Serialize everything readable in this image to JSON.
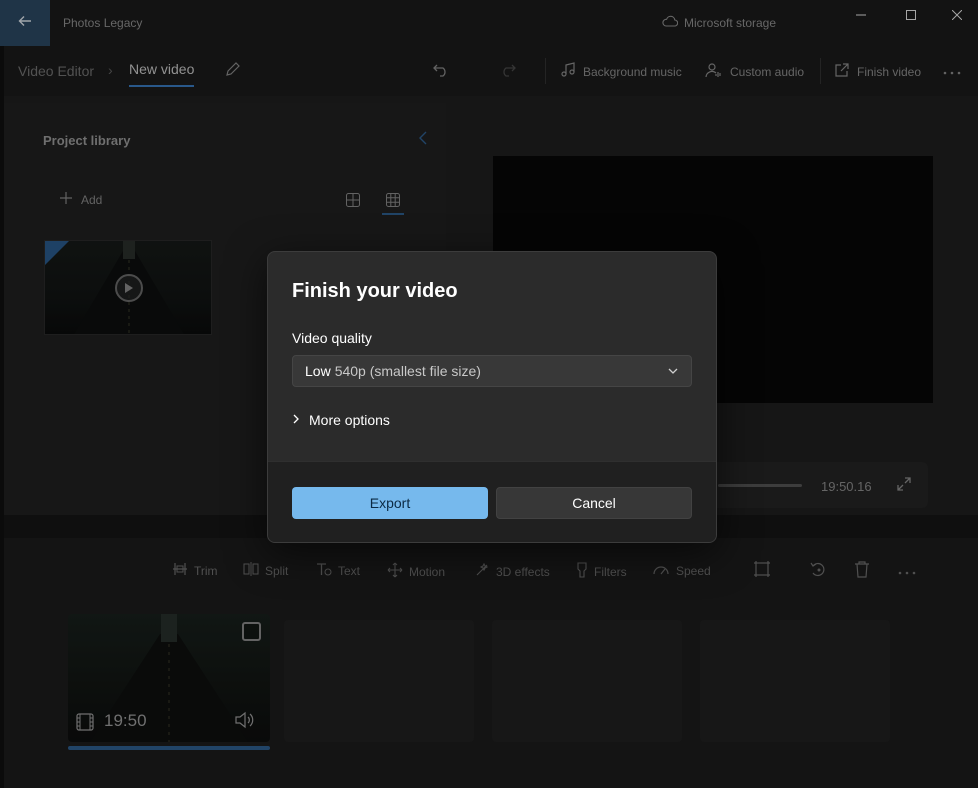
{
  "app": {
    "title": "Photos Legacy",
    "storage_label": "Microsoft storage"
  },
  "breadcrumb": {
    "root": "Video Editor",
    "separator": "›",
    "current": "New video"
  },
  "toolbar": {
    "background_music": "Background music",
    "custom_audio": "Custom audio",
    "finish_video": "Finish video"
  },
  "library": {
    "title": "Project library",
    "add_label": "Add"
  },
  "preview": {
    "time": "19:50.16"
  },
  "edit_toolbar": {
    "trim": "Trim",
    "split": "Split",
    "text": "Text",
    "motion": "Motion",
    "effects_3d": "3D effects",
    "filters": "Filters",
    "speed": "Speed"
  },
  "storyboard": {
    "clips": [
      {
        "duration": "19:50",
        "selected": false
      }
    ]
  },
  "dialog": {
    "title": "Finish your video",
    "quality_label": "Video quality",
    "quality_selected_main": "Low",
    "quality_selected_detail": "540p (smallest file size)",
    "more_options": "More options",
    "export_label": "Export",
    "cancel_label": "Cancel"
  },
  "colors": {
    "accent": "#76b9ed",
    "accent_dark": "#2e5f8f",
    "dialog_bg": "#2b2b2b",
    "footer_bg": "#202020"
  }
}
